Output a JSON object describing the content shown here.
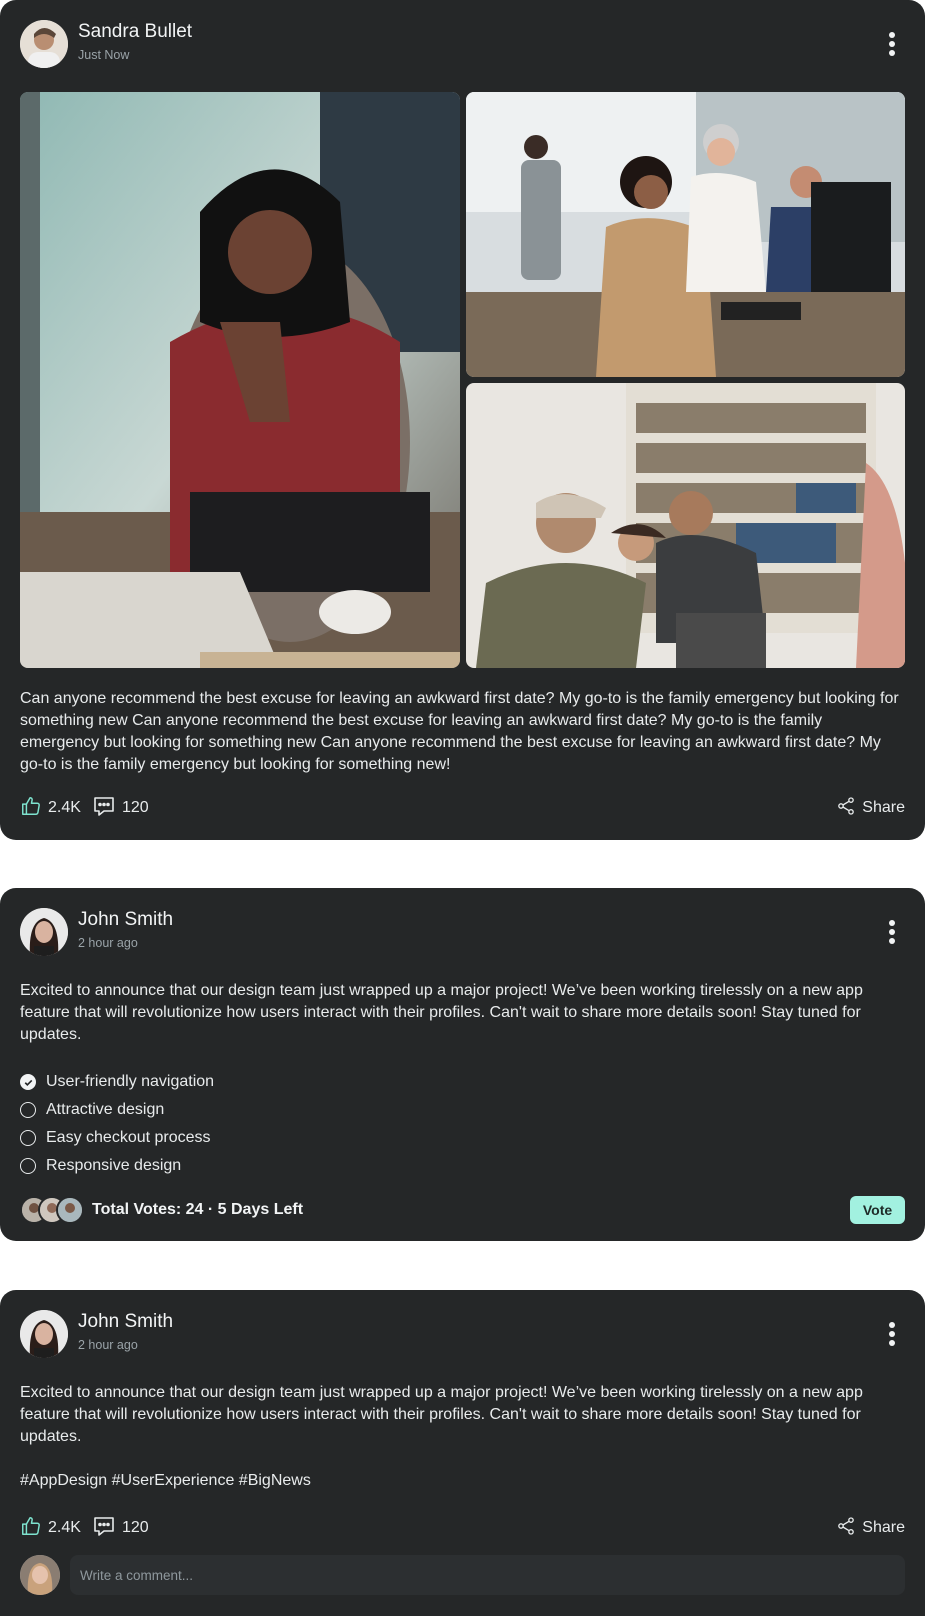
{
  "posts": [
    {
      "author": "Sandra Bullet",
      "time": "Just Now",
      "text": "Can anyone recommend the best excuse for leaving an awkward first date? My go-to is the family emergency but looking for something new Can anyone recommend the best excuse for leaving an awkward first date? My go-to is the family emergency but looking for something new Can anyone recommend the best excuse for leaving an awkward first date? My go-to is the family emergency but looking for something new!",
      "likes": "2.4K",
      "comments": "120",
      "share_label": "Share"
    },
    {
      "author": "John Smith",
      "time": "2 hour ago",
      "text": "Excited to announce that our design team just wrapped up a major project! We’ve been working tirelessly on a new app feature that will revolutionize how users interact with their profiles.  Can't wait to share more details soon! Stay tuned for updates.",
      "poll": {
        "options": [
          {
            "label": "User-friendly navigation",
            "checked": true
          },
          {
            "label": "Attractive design",
            "checked": false
          },
          {
            "label": "Easy checkout process",
            "checked": false
          },
          {
            "label": "Responsive design",
            "checked": false
          }
        ],
        "summary": "Total Votes: 24 · 5 Days Left",
        "vote_label": "Vote"
      }
    },
    {
      "author": "John Smith",
      "time": "2 hour ago",
      "text": "Excited to announce that our design team just wrapped up a major project! We’ve been working tirelessly on a new app feature that will revolutionize how users interact with their profiles.  Can't wait to share more details soon! Stay tuned for updates.",
      "hashtags": "#AppDesign #UserExperience #BigNews",
      "likes": "2.4K",
      "comments": "120",
      "share_label": "Share",
      "comment_placeholder": "Write a comment..."
    }
  ],
  "icons": {
    "more": "more-vertical-icon",
    "like": "thumbs-up-icon",
    "comment": "comment-bubble-icon",
    "share": "share-icon",
    "check": "check-icon"
  },
  "colors": {
    "card_bg": "#252728",
    "accent": "#a2f1e0",
    "like_icon": "#7ee3cf",
    "text": "#e8ebec",
    "muted": "#9aa3a8"
  }
}
